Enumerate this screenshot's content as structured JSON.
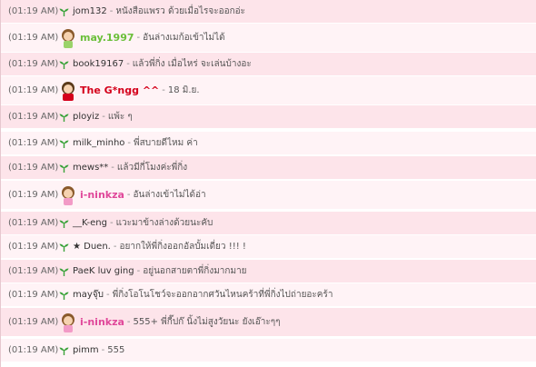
{
  "colors": {
    "row_alt": "#fde4ea",
    "row_norm": "#fff3f6",
    "sprout": "#3aa23a"
  },
  "messages": [
    {
      "time": "(01:19 AM)",
      "user": "jom132",
      "text": "หนังสือแพรว ด้วยเมื่อไรจะออกอ่ะ",
      "icon": "sprout-icon"
    },
    {
      "time": "(01:19 AM)",
      "user": "may.1997",
      "text": "อันล่างเมก้อเข้าไม่ได้",
      "icon": "girl-avatar-icon",
      "user_color": "#6bbf3a"
    },
    {
      "time": "(01:19 AM)",
      "user": "book19167",
      "text": "แล้วพี่กิ่ง เมื่อไหร่ จะเล่นบ้างอะ",
      "icon": "sprout-icon"
    },
    {
      "time": "(01:19 AM)",
      "user": "The G*ngg ^^",
      "text": "18 มิ.ย.",
      "icon": "red-girl-avatar-icon",
      "user_color": "#d4001a"
    },
    {
      "time": "(01:19 AM)",
      "user": "ployiz",
      "text": "แพ้ะ ๆ",
      "icon": "sprout-icon"
    },
    {
      "time": "(01:19 AM)",
      "user": "milk_minho",
      "text": "พี่สบายดีไหม ค่า",
      "icon": "sprout-icon"
    },
    {
      "time": "(01:19 AM)",
      "user": "mews**",
      "text": "แล้วมีกี่โมงค่ะพี่กิ่ง",
      "icon": "sprout-icon"
    },
    {
      "time": "(01:19 AM)",
      "user": "i-ninkza",
      "text": "อันล่างเข้าไม่ได้อ่า",
      "icon": "girl-avatar-icon",
      "user_color": "#e0489a"
    },
    {
      "time": "(01:19 AM)",
      "user": "__K-eng",
      "text": "แวะมาข้างล่างด้วยนะคับ",
      "icon": "sprout-icon"
    },
    {
      "time": "(01:19 AM)",
      "user": "★ Duen.",
      "text": "อยากให้พี่กิ่งออกอัลบั้มเดี่ยว !!! !",
      "icon": "sprout-icon"
    },
    {
      "time": "(01:19 AM)",
      "user": "PaeK luv ging",
      "text": "อยู่นอกสายตาพี่กิ่งมากมาย",
      "icon": "sprout-icon"
    },
    {
      "time": "(01:19 AM)",
      "user": "mayจุ๊บ",
      "text": "พี่กิ่งโอโนโชว์จะออกอากศวันไหนคร้าที่พี่กิ่งไปถ่ายอะคร้า",
      "icon": "sprout-icon"
    },
    {
      "time": "(01:19 AM)",
      "user": "i-ninkza",
      "text": "555+ พี่กี๊ปก๊ นิ้งไม่สูงวัยนะ ยังเอ๊าะๆๆ",
      "icon": "girl-avatar-icon",
      "user_color": "#e0489a"
    },
    {
      "time": "(01:19 AM)",
      "user": "pimm",
      "text": "555",
      "icon": "sprout-icon"
    }
  ]
}
